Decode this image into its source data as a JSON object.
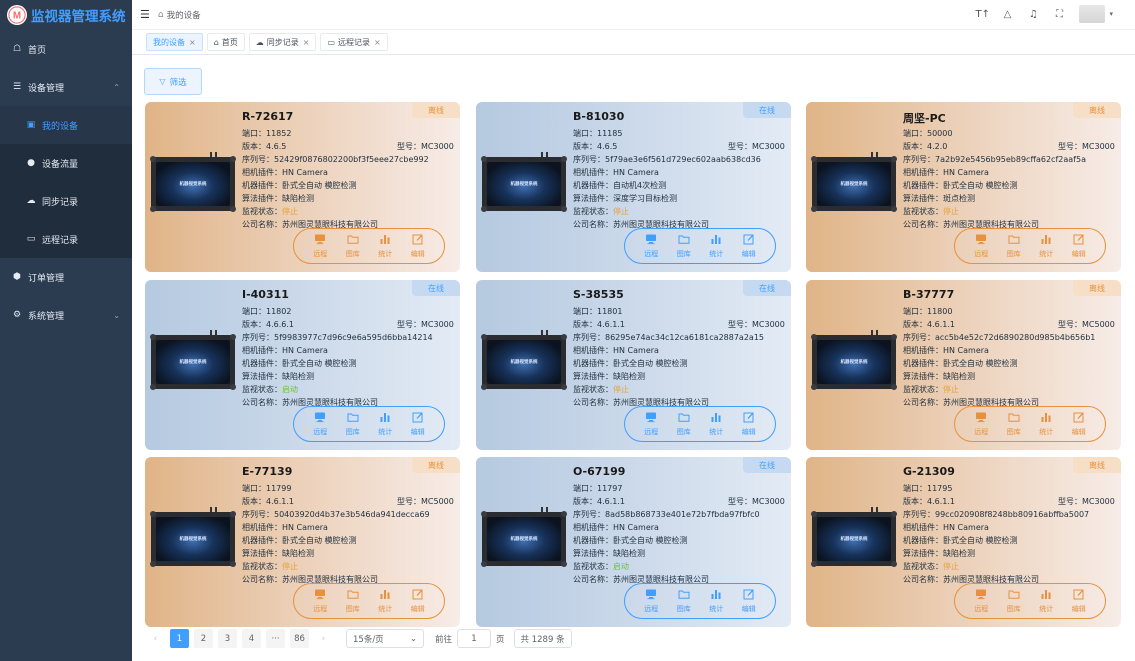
{
  "app": {
    "title": "监视器管理系统"
  },
  "sidebar": {
    "items": [
      {
        "label": "首页",
        "icon": "home-icon"
      },
      {
        "label": "设备管理",
        "icon": "sliders-icon"
      },
      {
        "label": "我的设备",
        "icon": "monitor-icon"
      },
      {
        "label": "设备流量",
        "icon": "dot-icon"
      },
      {
        "label": "同步记录",
        "icon": "cloud-icon"
      },
      {
        "label": "远程记录",
        "icon": "screen-icon"
      },
      {
        "label": "订单管理",
        "icon": "cube-icon"
      },
      {
        "label": "系统管理",
        "icon": "gear-icon"
      }
    ]
  },
  "header": {
    "breadcrumb": "我的设备"
  },
  "tabs": [
    {
      "label": "我的设备"
    },
    {
      "label": "首页"
    },
    {
      "label": "同步记录"
    },
    {
      "label": "远程记录"
    }
  ],
  "filter": {
    "label": "筛选"
  },
  "field_labels": {
    "port": "端口：",
    "version": "版本：",
    "model": "型号：",
    "serial": "序列号：",
    "camera": "相机插件：",
    "machine": "机器插件：",
    "algorithm": "算法插件：",
    "monitor": "监视状态：",
    "company": "公司名称："
  },
  "actions": [
    "远程",
    "图库",
    "统计",
    "编辑"
  ],
  "device_screen_text": "机器视觉系统",
  "cards": [
    {
      "title": "R-72617",
      "status": "离线",
      "port": "11852",
      "version": "4.6.5",
      "model": "MC3000",
      "serial": "52429f0876802200bf3f5eee27cbe992",
      "camera": "HN Camera",
      "machine": "卧式全自动 模腔检测",
      "algorithm": "缺陷检测",
      "monitor": "停止",
      "company": "苏州图灵慧眼科技有限公司"
    },
    {
      "title": "B-81030",
      "status": "在线",
      "port": "11185",
      "version": "4.6.5",
      "model": "MC3000",
      "serial": "5f79ae3e6f561d729ec602aab638cd36",
      "camera": "HN Camera",
      "machine": "自动机4次检测",
      "algorithm": "深度学习目标检测",
      "monitor": "停止",
      "company": "苏州图灵慧眼科技有限公司"
    },
    {
      "title": "周坚-PC",
      "status": "离线",
      "port": "50000",
      "version": "4.2.0",
      "model": "MC3000",
      "serial": "7a2b92e5456b95eb89cffa62cf2aaf5a",
      "camera": "HN Camera",
      "machine": "卧式全自动 模腔检测",
      "algorithm": "斑点检测",
      "monitor": "停止",
      "company": "苏州图灵慧眼科技有限公司"
    },
    {
      "title": "I-40311",
      "status": "在线",
      "port": "11802",
      "version": "4.6.6.1",
      "model": "MC3000",
      "serial": "5f9983977c7d96c9e6a595d6bba14214",
      "camera": "HN Camera",
      "machine": "卧式全自动 模腔检测",
      "algorithm": "缺陷检测",
      "monitor": "启动",
      "company": "苏州图灵慧眼科技有限公司"
    },
    {
      "title": "S-38535",
      "status": "在线",
      "port": "11801",
      "version": "4.6.1.1",
      "model": "MC3000",
      "serial": "86295e74ac34c12ca6181ca2887a2a15",
      "camera": "HN Camera",
      "machine": "卧式全自动 模腔检测",
      "algorithm": "缺陷检测",
      "monitor": "停止",
      "company": "苏州图灵慧眼科技有限公司"
    },
    {
      "title": "B-37777",
      "status": "离线",
      "port": "11800",
      "version": "4.6.1.1",
      "model": "MC5000",
      "serial": "acc5b4e52c72d6890280d985b4b656b1",
      "camera": "HN Camera",
      "machine": "卧式全自动 模腔检测",
      "algorithm": "缺陷检测",
      "monitor": "停止",
      "company": "苏州图灵慧眼科技有限公司"
    },
    {
      "title": "E-77139",
      "status": "离线",
      "port": "11799",
      "version": "4.6.1.1",
      "model": "MC5000",
      "serial": "50403920d4b37e3b546da941decca69",
      "camera": "HN Camera",
      "machine": "卧式全自动 模腔检测",
      "algorithm": "缺陷检测",
      "monitor": "停止",
      "company": "苏州图灵慧眼科技有限公司"
    },
    {
      "title": "O-67199",
      "status": "在线",
      "port": "11797",
      "version": "4.6.1.1",
      "model": "MC3000",
      "serial": "8ad58b868733e401e72b7fbda97fbfc0",
      "camera": "HN Camera",
      "machine": "卧式全自动 模腔检测",
      "algorithm": "缺陷检测",
      "monitor": "启动",
      "company": "苏州图灵慧眼科技有限公司"
    },
    {
      "title": "G-21309",
      "status": "离线",
      "port": "11795",
      "version": "4.6.1.1",
      "model": "MC3000",
      "serial": "99cc020908f8248bb80916abffba5007",
      "camera": "HN Camera",
      "machine": "卧式全自动 模腔检测",
      "algorithm": "缺陷检测",
      "monitor": "停止",
      "company": "苏州图灵慧眼科技有限公司"
    }
  ],
  "pagination": {
    "pages": [
      "1",
      "2",
      "3",
      "4",
      "···",
      "86"
    ],
    "current": "1",
    "page_size": "15条/页",
    "goto_label": "前往",
    "goto_value": "1",
    "page_suffix": "页",
    "total": "共 1289 条"
  },
  "colors": {
    "accent": "#409eff",
    "offline": "#e6913d",
    "sidebar": "#2b3c51"
  }
}
